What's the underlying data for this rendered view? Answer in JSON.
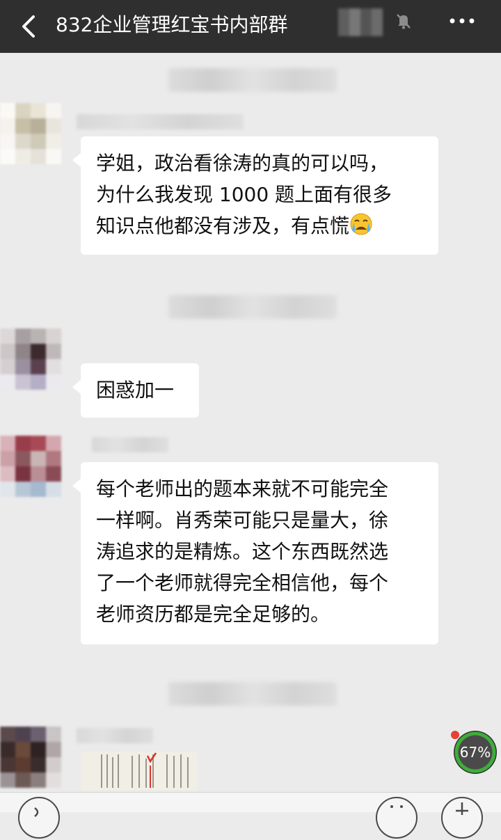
{
  "header": {
    "title": "832企业管理红宝书内部群",
    "back_icon": "chevron-left-icon",
    "mute_icon": "bell-muted-icon",
    "more_icon": "more-dots-icon"
  },
  "messages": [
    {
      "lines": [
        "学姐，政治看徐涛的真的可以吗，",
        "为什么我发现 1000 题上面有很多",
        "知识点他都没有涉及，有点慌"
      ],
      "emoji": "crying-face-icon"
    },
    {
      "lines": [
        "困惑加一"
      ]
    },
    {
      "lines": [
        "每个老师出的题本来就不可能完全",
        "一样啊。肖秀荣可能只是量大，徐",
        "涛追求的是精炼。这个东西既然选",
        "了一个老师就得完全相信他，每个",
        "老师资历都是完全足够的。"
      ]
    }
  ],
  "progress": {
    "value": "67%",
    "accent": "#3fae3a"
  },
  "colors": {
    "header_bg": "#2f2f2f",
    "chat_bg": "#ebebeb",
    "bubble_bg": "#ffffff"
  }
}
